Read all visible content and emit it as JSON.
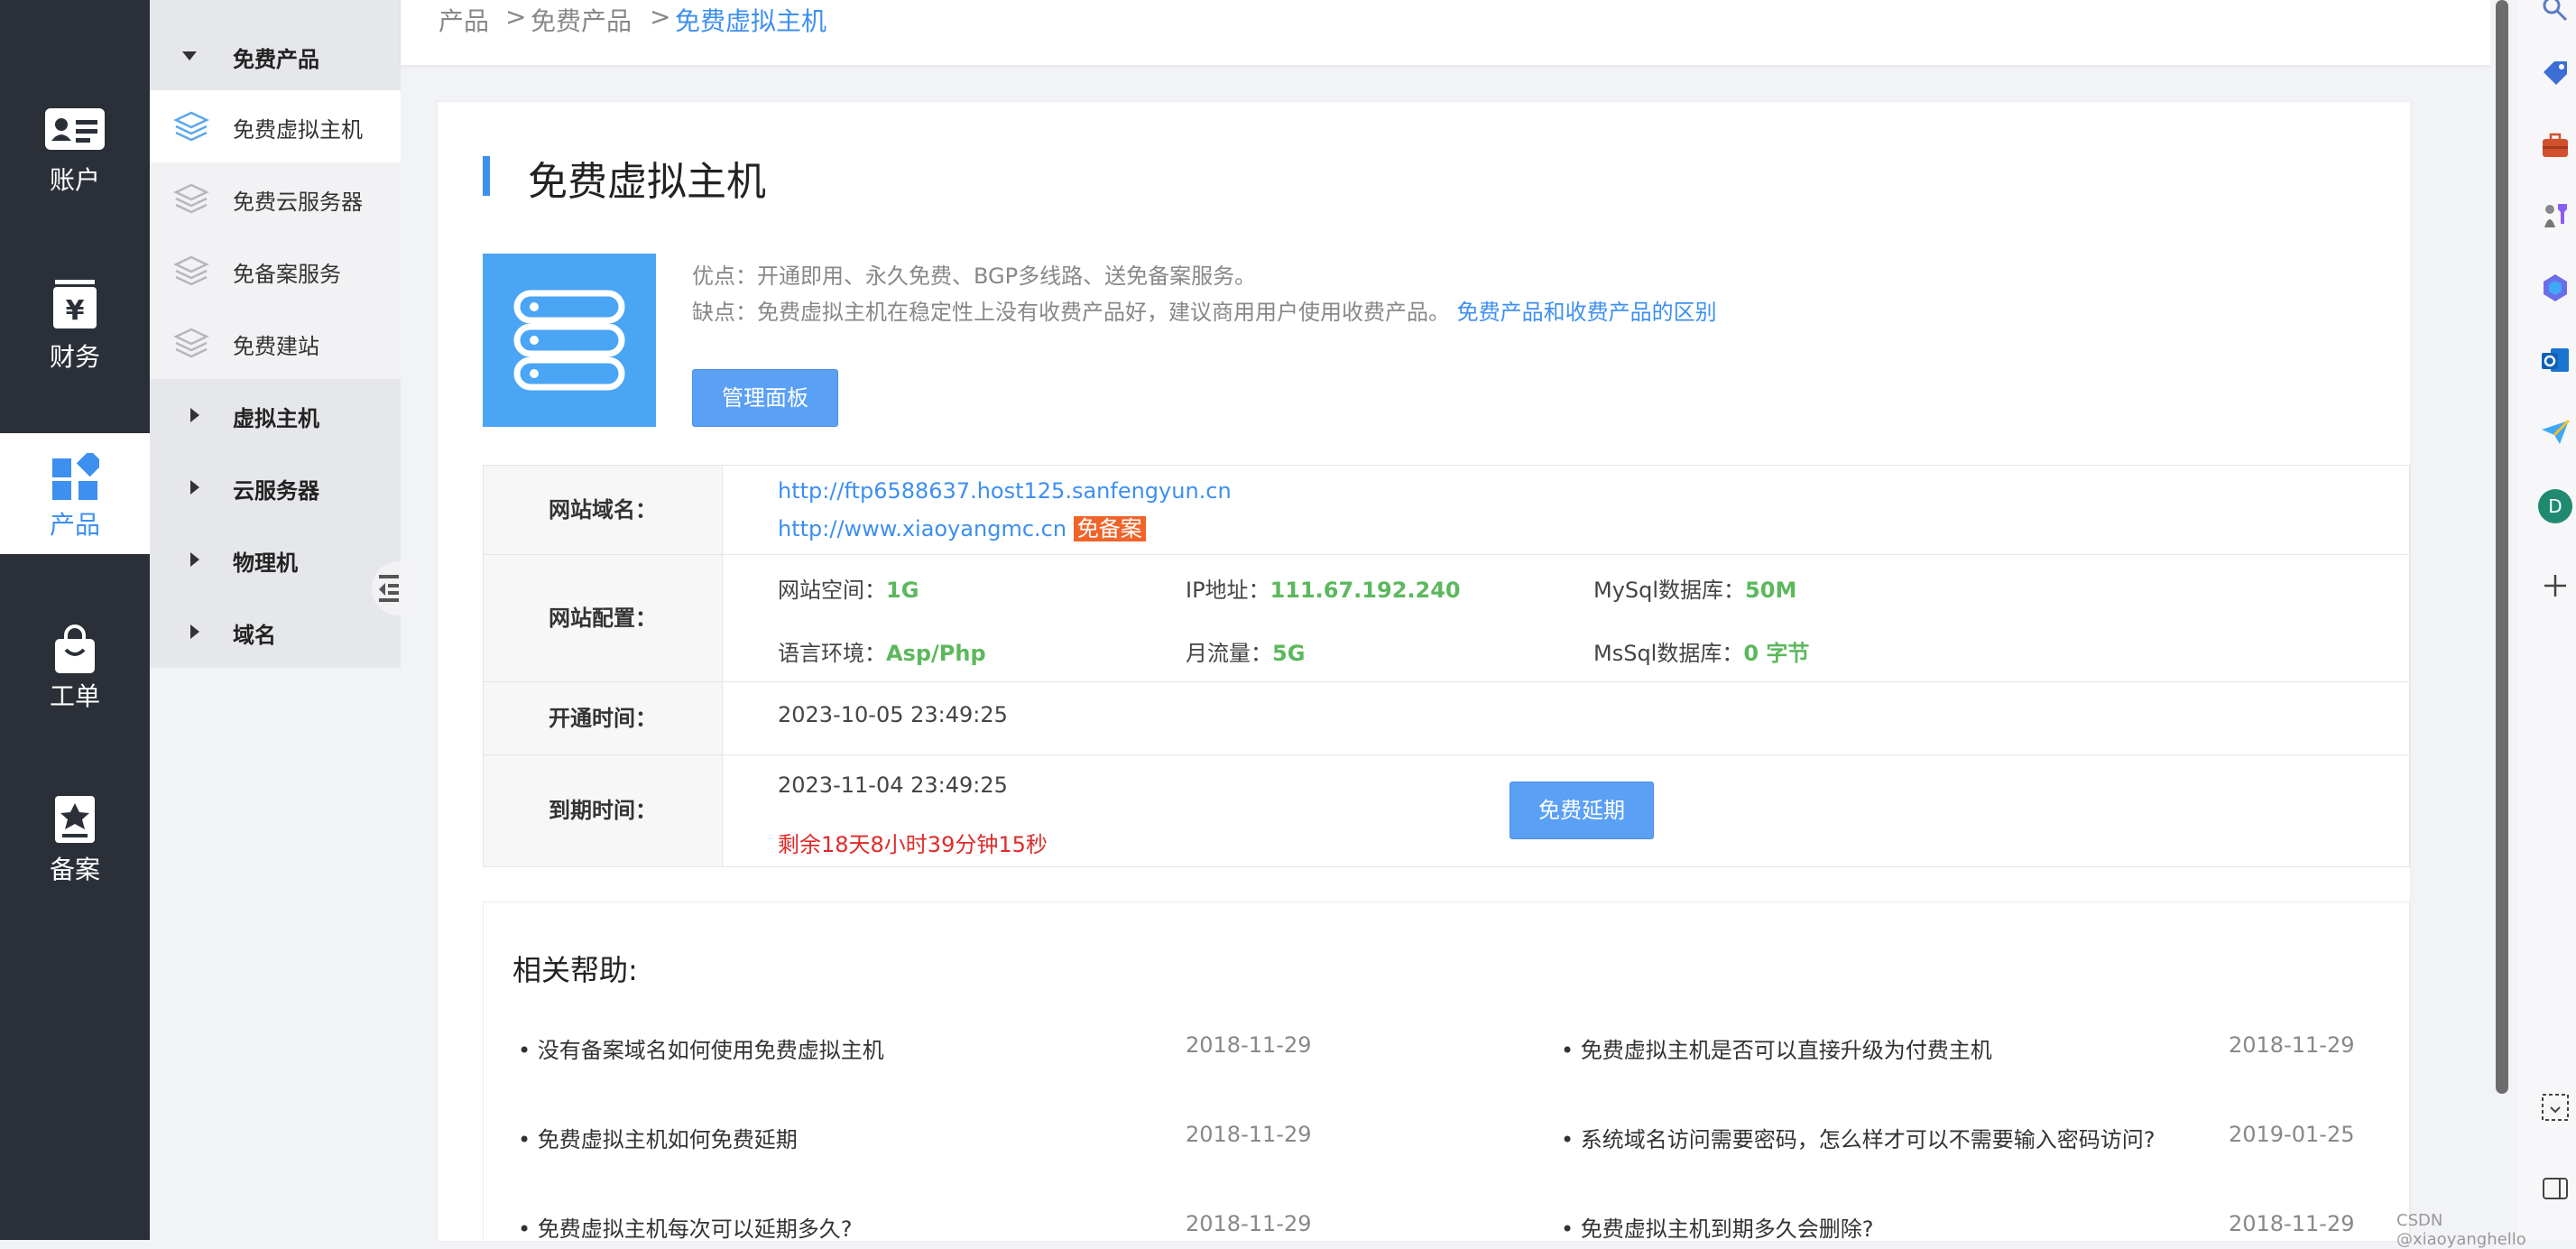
{
  "rail": [
    {
      "label": "账户",
      "icon": "account-card-icon"
    },
    {
      "label": "财务",
      "icon": "finance-yen-icon"
    },
    {
      "label": "产品",
      "icon": "product-grid-icon",
      "active": true
    },
    {
      "label": "工单",
      "icon": "ticket-bag-icon"
    },
    {
      "label": "备案",
      "icon": "filing-star-icon"
    }
  ],
  "subnav": {
    "group_open": "免费产品",
    "children": [
      "免费虚拟主机",
      "免费云服务器",
      "免备案服务",
      "免费建站"
    ],
    "groups": [
      "虚拟主机",
      "云服务器",
      "物理机",
      "域名"
    ]
  },
  "breadcrumb": [
    "产品",
    ">",
    "免费产品",
    ">",
    "免费虚拟主机"
  ],
  "page_title": "免费虚拟主机",
  "pros": "优点：开通即用、永久免费、BGP多线路、送免备案服务。",
  "cons": "缺点：免费虚拟主机在稳定性上没有收费产品好，建议商用用户使用收费产品。",
  "diff_link": "免费产品和收费产品的区别",
  "btn_panel": "管理面板",
  "info": {
    "domain_label": "网站域名：",
    "domain1": "http://ftp6588637.host125.sanfengyun.cn",
    "domain2": "http://www.xiaoyangmc.cn",
    "domain2_tag": "免备案",
    "config_label": "网站配置：",
    "space_k": "网站空间：",
    "space_v": "1G",
    "ip_k": "IP地址：",
    "ip_v": "111.67.192.240",
    "mysql_k": "MySql数据库：",
    "mysql_v": "50M",
    "lang_k": "语言环境：",
    "lang_v": "Asp/Php",
    "flow_k": "月流量：",
    "flow_v": "5G",
    "mssql_k": "MsSql数据库：",
    "mssql_v": "0 字节",
    "open_label": "开通时间：",
    "open_v": "2023-10-05 23:49:25",
    "expire_label": "到期时间：",
    "expire_v": "2023-11-04 23:49:25",
    "remain": "剩余18天8小时39分钟15秒",
    "btn_extend": "免费延期"
  },
  "help": {
    "title": "相关帮助:",
    "items": [
      {
        "text": "• 没有备案域名如何使用免费虚拟主机",
        "date": "2018-11-29"
      },
      {
        "text": "• 免费虚拟主机是否可以直接升级为付费主机",
        "date": "2018-11-29"
      },
      {
        "text": "• 免费虚拟主机如何免费延期",
        "date": "2018-11-29"
      },
      {
        "text": "• 系统域名访问需要密码，怎么样才可以不需要输入密码访问?",
        "date": "2019-01-25"
      },
      {
        "text": "• 免费虚拟主机每次可以延期多久?",
        "date": "2018-11-29"
      },
      {
        "text": "• 免费虚拟主机到期多久会删除?",
        "date": "2018-11-29"
      }
    ]
  },
  "right_bar": {
    "profile_letter": "D",
    "watermark": "CSDN @xiaoyanghello"
  },
  "colors": {
    "accent": "#3d8ff0",
    "rail_bg": "#2b3038",
    "green": "#5cb85c",
    "red": "#e02a2a",
    "tag": "#f0642a"
  }
}
